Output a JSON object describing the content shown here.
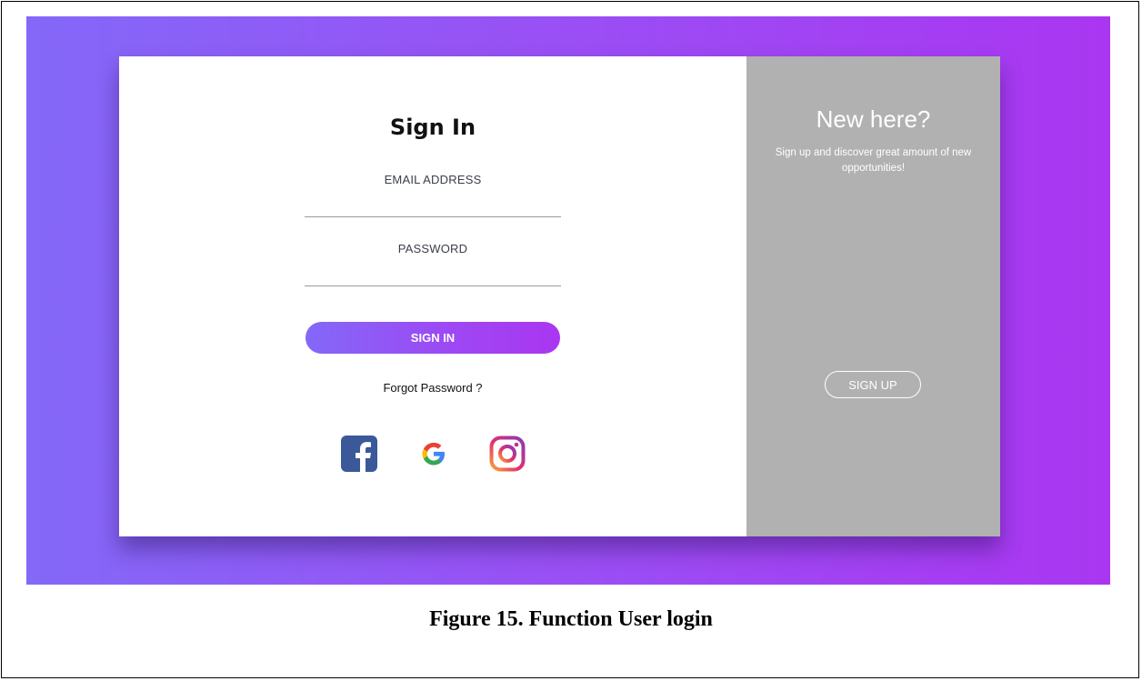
{
  "signin": {
    "title": "Sign In",
    "email_label": "EMAIL ADDRESS",
    "email_value": "",
    "password_label": "PASSWORD",
    "password_value": "",
    "button_label": "SIGN IN",
    "forgot_label": "Forgot Password ?",
    "social": [
      {
        "icon": "facebook-icon"
      },
      {
        "icon": "google-icon"
      },
      {
        "icon": "instagram-icon"
      }
    ]
  },
  "signup": {
    "heading": "New here?",
    "description": "Sign up and discover great amount of new opportunities!",
    "button_label": "SIGN UP"
  },
  "caption": "Figure 15. Function User login",
  "colors": {
    "gradient_start": "#8468f8",
    "gradient_end": "#aa36f1",
    "right_panel": "#b1b1b1",
    "facebook": "#3b5998"
  }
}
